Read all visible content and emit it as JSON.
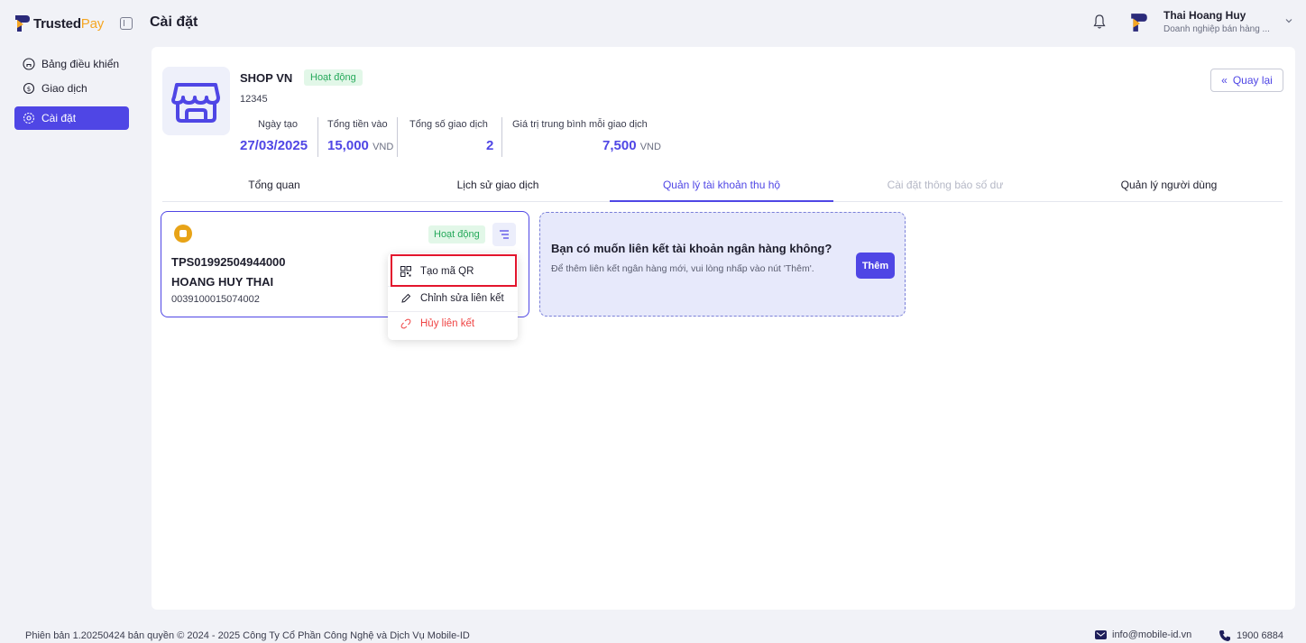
{
  "app": {
    "logo_trusted": "Trusted",
    "logo_pay": "Pay",
    "page_title": "Cài đặt",
    "brand_color": "#4f46e5"
  },
  "user": {
    "name": "Thai Hoang Huy",
    "role": "Doanh nghiệp bán hàng ..."
  },
  "sidebar": {
    "items": [
      {
        "label": "Bảng điều khiển",
        "icon": "home-icon"
      },
      {
        "label": "Giao dịch",
        "icon": "transaction-icon"
      },
      {
        "label": "Cài đặt",
        "icon": "settings-icon",
        "active": true
      }
    ]
  },
  "shop": {
    "name": "SHOP VN",
    "status": "Hoạt động",
    "id": "12345",
    "back_label": "Quay lại",
    "stats": [
      {
        "label": "Ngày tạo",
        "value": "27/03/2025",
        "unit": ""
      },
      {
        "label": "Tổng tiền vào",
        "value": "15,000",
        "unit": "VND"
      },
      {
        "label": "Tổng số giao dịch",
        "value": "2",
        "unit": ""
      },
      {
        "label": "Giá trị trung bình mỗi giao dịch",
        "value": "7,500",
        "unit": "VND"
      }
    ]
  },
  "tabs": [
    {
      "label": "Tổng quan",
      "state": "normal"
    },
    {
      "label": "Lịch sử giao dịch",
      "state": "normal"
    },
    {
      "label": "Quản lý tài khoản thu hộ",
      "state": "active"
    },
    {
      "label": "Cài đặt thông báo số dư",
      "state": "disabled"
    },
    {
      "label": "Quản lý người dùng",
      "state": "normal"
    }
  ],
  "account": {
    "status": "Hoạt động",
    "code": "TPS01992504944000",
    "holder": "HOANG HUY THAI",
    "number": "0039100015074002"
  },
  "menu": {
    "items": [
      {
        "label": "Tạo mã QR",
        "icon": "qr-code-icon"
      },
      {
        "label": "Chỉnh sửa liên kết",
        "icon": "pencil-icon"
      },
      {
        "label": "Hủy liên kết",
        "icon": "unlink-icon",
        "danger": true
      }
    ]
  },
  "promo": {
    "title": "Bạn có muốn liên kết tài khoản ngân hàng không?",
    "desc": "Để thêm liên kết ngân hàng mới, vui lòng nhấp vào nút 'Thêm'.",
    "button": "Thêm"
  },
  "footer": {
    "copyright": "Phiên bản 1.20250424 bản quyền © 2024 - 2025 Công Ty Cổ Phần Công Nghệ và Dịch Vụ Mobile-ID",
    "email": "info@mobile-id.vn",
    "phone": "1900 6884"
  }
}
